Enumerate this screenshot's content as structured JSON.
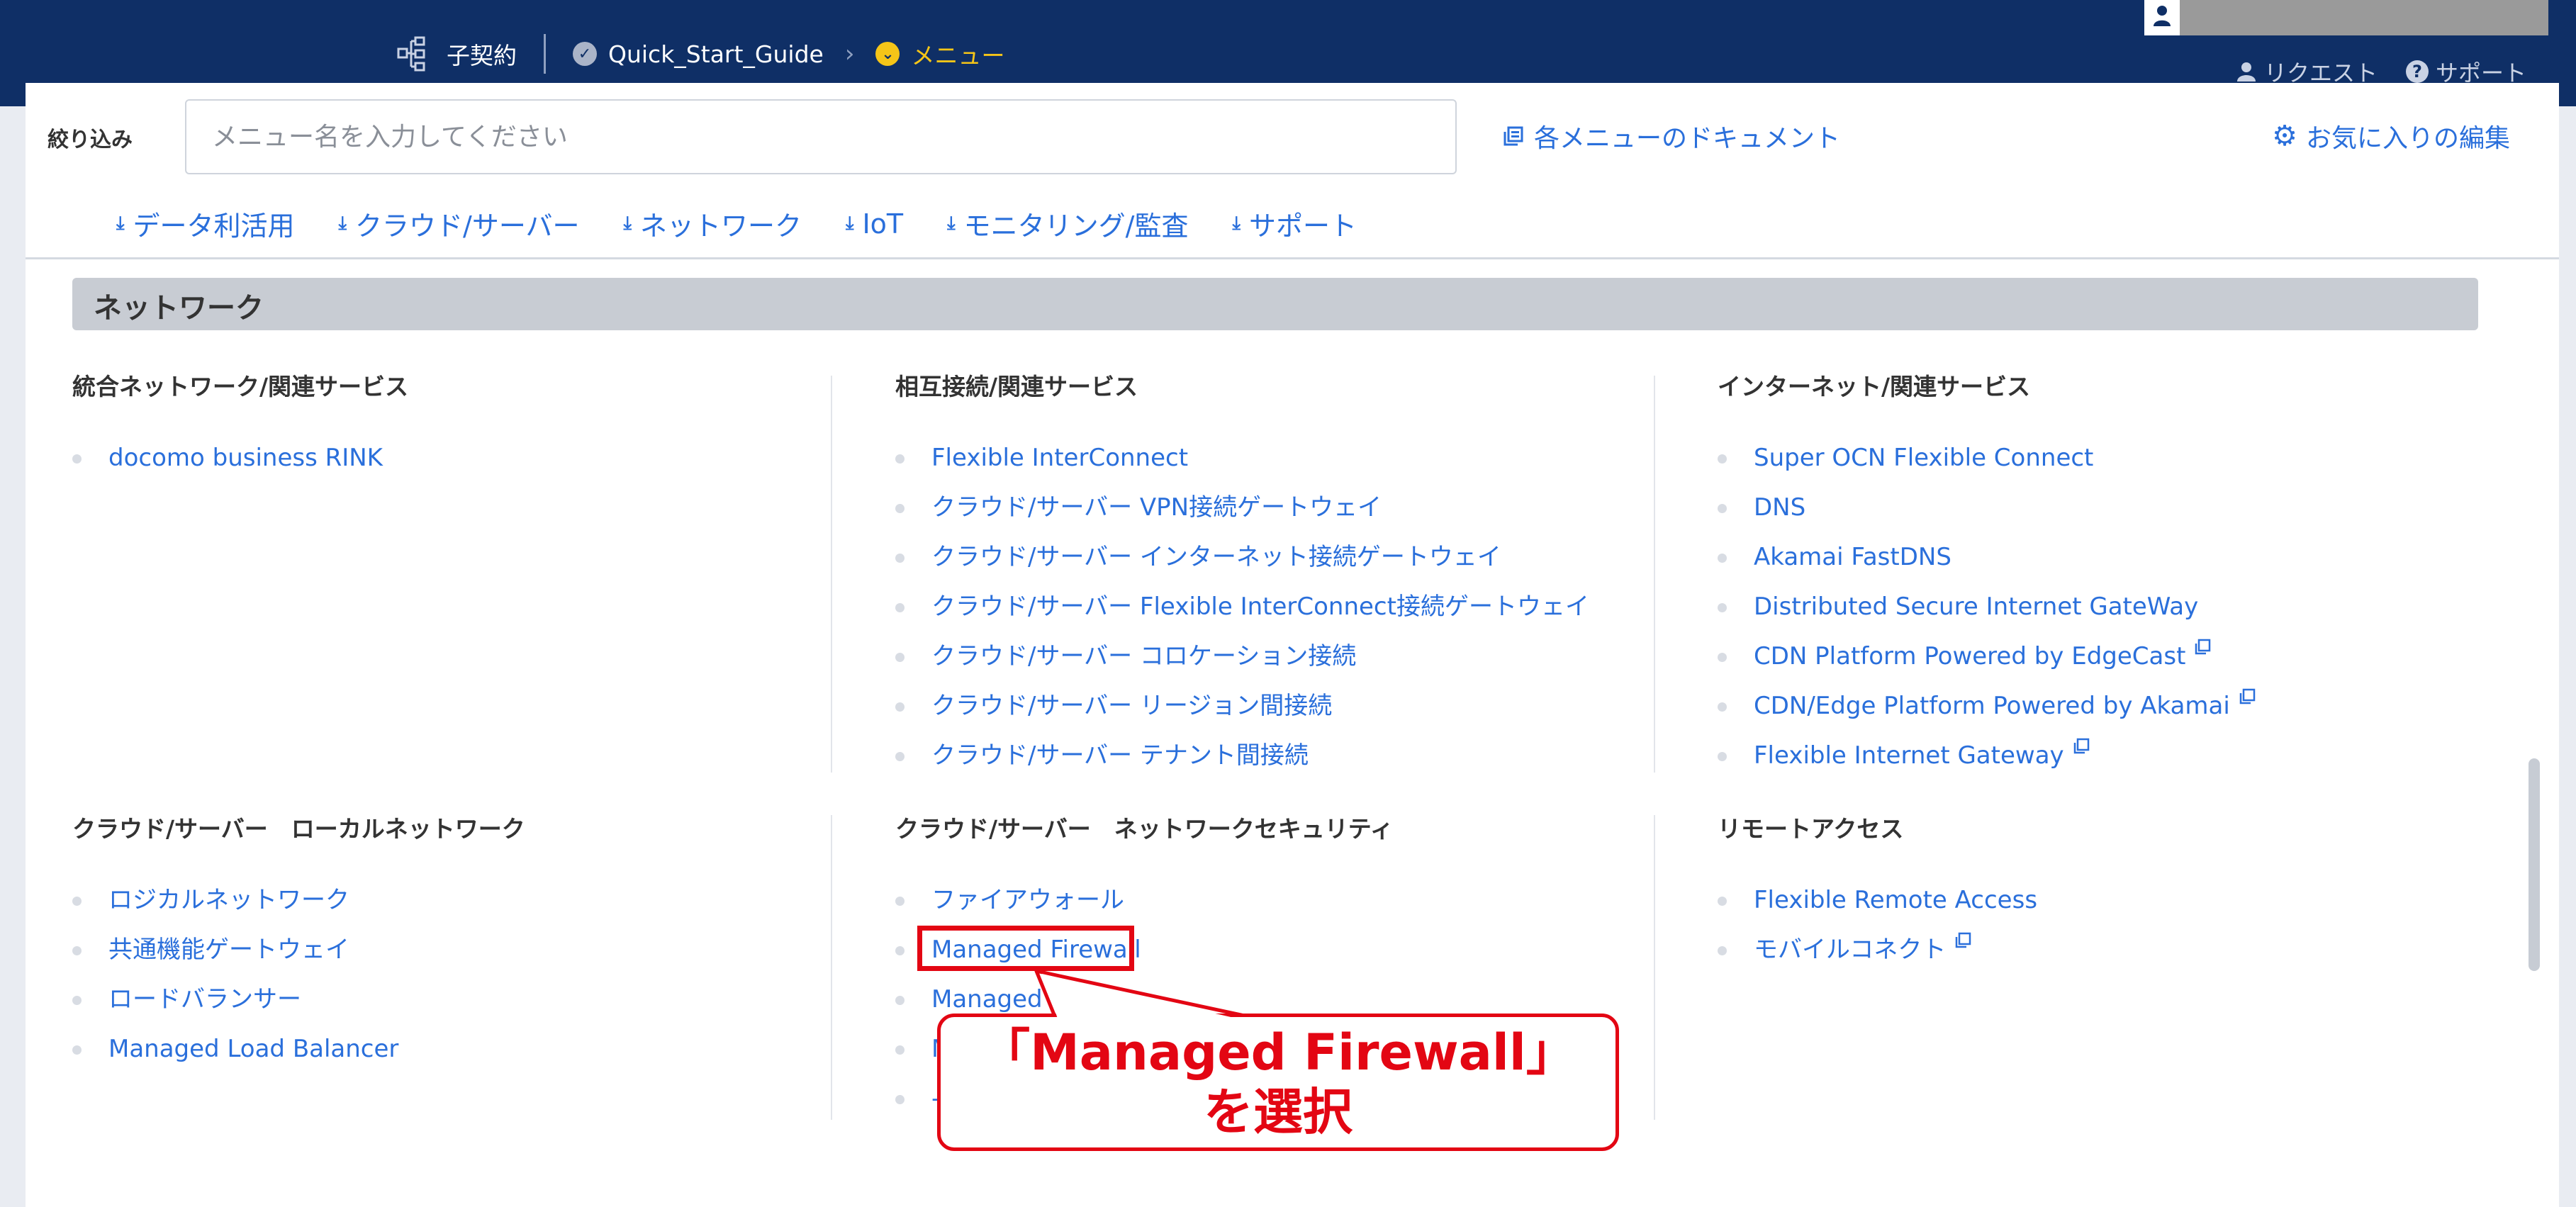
{
  "header": {
    "breadcrumb": [
      {
        "label": "子契約",
        "icon": "hierarchy-icon"
      },
      {
        "label": "Quick_Start_Guide",
        "icon": "check-circle-icon"
      },
      {
        "label": "メニュー",
        "icon": "chevron-circle-icon"
      }
    ],
    "links": [
      {
        "label": "リクエスト",
        "icon": "person-icon"
      },
      {
        "label": "サポート",
        "icon": "question-icon"
      }
    ]
  },
  "filter": {
    "label": "絞り込み",
    "placeholder": "メニュー名を入力してください",
    "value": ""
  },
  "doc_link": "各メニューのドキュメント",
  "fav_link": "お気に入りの編集",
  "categories": [
    "データ利活用",
    "クラウド/サーバー",
    "ネットワーク",
    "IoT",
    "モニタリング/監査",
    "サポート"
  ],
  "section": {
    "title": "ネットワーク",
    "columns": [
      {
        "heading": "統合ネットワーク/関連サービス",
        "items": [
          {
            "label": "docomo business RINK",
            "external": false
          }
        ]
      },
      {
        "heading": "相互接続/関連サービス",
        "items": [
          {
            "label": "Flexible InterConnect",
            "external": false
          },
          {
            "label": "クラウド/サーバー VPN接続ゲートウェイ",
            "external": false
          },
          {
            "label": "クラウド/サーバー インターネット接続ゲートウェイ",
            "external": false
          },
          {
            "label": "クラウド/サーバー Flexible InterConnect接続ゲートウェイ",
            "external": false
          },
          {
            "label": "クラウド/サーバー コロケーション接続",
            "external": false
          },
          {
            "label": "クラウド/サーバー リージョン間接続",
            "external": false
          },
          {
            "label": "クラウド/サーバー テナント間接続",
            "external": false
          }
        ]
      },
      {
        "heading": "インターネット/関連サービス",
        "items": [
          {
            "label": "Super OCN Flexible Connect",
            "external": false
          },
          {
            "label": "DNS",
            "external": false
          },
          {
            "label": "Akamai FastDNS",
            "external": false
          },
          {
            "label": "Distributed Secure Internet GateWay",
            "external": false
          },
          {
            "label": "CDN Platform Powered by EdgeCast",
            "external": true
          },
          {
            "label": "CDN/Edge Platform Powered by Akamai",
            "external": true
          },
          {
            "label": "Flexible Internet Gateway",
            "external": true
          }
        ]
      },
      {
        "heading": "クラウド/サーバー　ローカルネットワーク",
        "items": [
          {
            "label": "ロジカルネットワーク",
            "external": false
          },
          {
            "label": "共通機能ゲートウェイ",
            "external": false
          },
          {
            "label": "ロードバランサー",
            "external": false
          },
          {
            "label": "Managed Load Balancer",
            "external": false
          }
        ]
      },
      {
        "heading": "クラウド/サーバー　ネットワークセキュリティ",
        "items": [
          {
            "label": "ファイアウォール",
            "external": false
          },
          {
            "label": "Managed Firewall",
            "external": false
          },
          {
            "label": "Managed U",
            "external": false
          },
          {
            "label": "M",
            "external": false
          },
          {
            "label": "-",
            "external": false
          }
        ]
      },
      {
        "heading": "リモートアクセス",
        "items": [
          {
            "label": "Flexible Remote Access",
            "external": false
          },
          {
            "label": "モバイルコネクト",
            "external": true
          }
        ]
      }
    ]
  },
  "annotation": {
    "line1": "「Managed Firewall」",
    "line2": "を選択",
    "color": "#e30613"
  },
  "colors": {
    "header_bg": "#0f2f66",
    "link": "#2a6fdb",
    "active_crumb": "#f5c518"
  }
}
